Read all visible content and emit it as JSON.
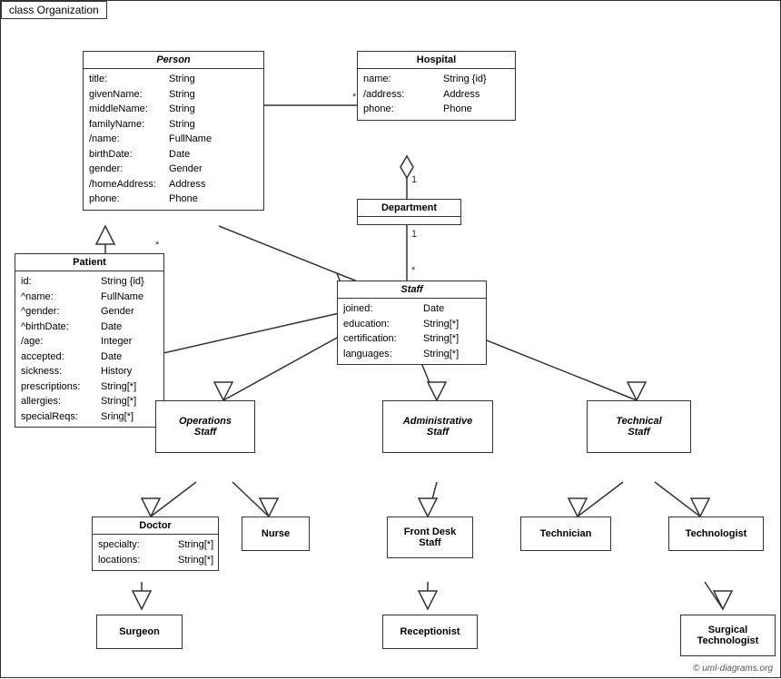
{
  "title": "class Organization",
  "copyright": "© uml-diagrams.org",
  "classes": {
    "person": {
      "name": "Person",
      "italic": true,
      "attrs": [
        {
          "name": "title:",
          "type": "String"
        },
        {
          "name": "givenName:",
          "type": "String"
        },
        {
          "name": "middleName:",
          "type": "String"
        },
        {
          "name": "familyName:",
          "type": "String"
        },
        {
          "name": "/name:",
          "type": "FullName"
        },
        {
          "name": "birthDate:",
          "type": "Date"
        },
        {
          "name": "gender:",
          "type": "Gender"
        },
        {
          "name": "/homeAddress:",
          "type": "Address"
        },
        {
          "name": "phone:",
          "type": "Phone"
        }
      ]
    },
    "hospital": {
      "name": "Hospital",
      "italic": false,
      "attrs": [
        {
          "name": "name:",
          "type": "String {id}"
        },
        {
          "name": "/address:",
          "type": "Address"
        },
        {
          "name": "phone:",
          "type": "Phone"
        }
      ]
    },
    "department": {
      "name": "Department",
      "italic": false,
      "attrs": []
    },
    "staff": {
      "name": "Staff",
      "italic": true,
      "attrs": [
        {
          "name": "joined:",
          "type": "Date"
        },
        {
          "name": "education:",
          "type": "String[*]"
        },
        {
          "name": "certification:",
          "type": "String[*]"
        },
        {
          "name": "languages:",
          "type": "String[*]"
        }
      ]
    },
    "patient": {
      "name": "Patient",
      "italic": false,
      "attrs": [
        {
          "name": "id:",
          "type": "String {id}"
        },
        {
          "name": "^name:",
          "type": "FullName"
        },
        {
          "name": "^gender:",
          "type": "Gender"
        },
        {
          "name": "^birthDate:",
          "type": "Date"
        },
        {
          "name": "/age:",
          "type": "Integer"
        },
        {
          "name": "accepted:",
          "type": "Date"
        },
        {
          "name": "sickness:",
          "type": "History"
        },
        {
          "name": "prescriptions:",
          "type": "String[*]"
        },
        {
          "name": "allergies:",
          "type": "String[*]"
        },
        {
          "name": "specialReqs:",
          "type": "Sring[*]"
        }
      ]
    },
    "operations_staff": {
      "name": "Operations\nStaff",
      "italic": true,
      "attrs": []
    },
    "administrative_staff": {
      "name": "Administrative\nStaff",
      "italic": true,
      "attrs": []
    },
    "technical_staff": {
      "name": "Technical\nStaff",
      "italic": true,
      "attrs": []
    },
    "doctor": {
      "name": "Doctor",
      "italic": false,
      "attrs": [
        {
          "name": "specialty:",
          "type": "String[*]"
        },
        {
          "name": "locations:",
          "type": "String[*]"
        }
      ]
    },
    "nurse": {
      "name": "Nurse",
      "italic": false,
      "attrs": []
    },
    "front_desk_staff": {
      "name": "Front Desk\nStaff",
      "italic": false,
      "attrs": []
    },
    "technician": {
      "name": "Technician",
      "italic": false,
      "attrs": []
    },
    "technologist": {
      "name": "Technologist",
      "italic": false,
      "attrs": []
    },
    "surgeon": {
      "name": "Surgeon",
      "italic": false,
      "attrs": []
    },
    "receptionist": {
      "name": "Receptionist",
      "italic": false,
      "attrs": []
    },
    "surgical_technologist": {
      "name": "Surgical\nTechnologist",
      "italic": false,
      "attrs": []
    }
  }
}
